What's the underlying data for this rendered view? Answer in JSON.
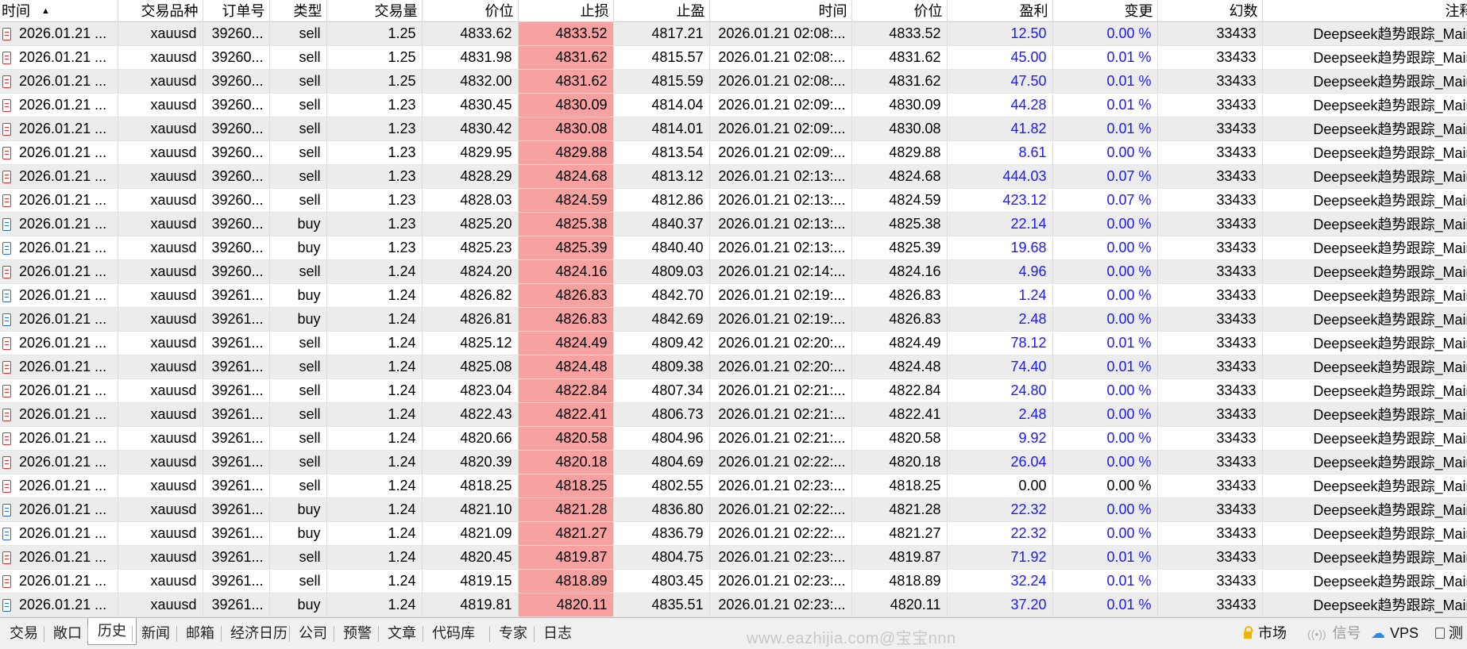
{
  "table": {
    "headers": [
      "时间",
      "交易品种",
      "订单号",
      "类型",
      "交易量",
      "价位",
      "止损",
      "止盈",
      "时间",
      "价位",
      "盈利",
      "变更",
      "幻数",
      "注释"
    ],
    "rows": [
      {
        "side": "sell",
        "time": "2026.01.21 ...",
        "symbol": "xauusd",
        "order": "39260...",
        "type": "sell",
        "volume": "1.25",
        "price": "4833.62",
        "sl": "4833.52",
        "tp": "4817.21",
        "close_time": "2026.01.21 02:08:...",
        "close_price": "4833.52",
        "profit": "12.50",
        "change": "0.00 %",
        "magic": "33433",
        "comment": "Deepseek趋势跟踪_Main",
        "profit_blue": true
      },
      {
        "side": "sell",
        "time": "2026.01.21 ...",
        "symbol": "xauusd",
        "order": "39260...",
        "type": "sell",
        "volume": "1.25",
        "price": "4831.98",
        "sl": "4831.62",
        "tp": "4815.57",
        "close_time": "2026.01.21 02:08:...",
        "close_price": "4831.62",
        "profit": "45.00",
        "change": "0.01 %",
        "magic": "33433",
        "comment": "Deepseek趋势跟踪_Main",
        "profit_blue": true
      },
      {
        "side": "sell",
        "time": "2026.01.21 ...",
        "symbol": "xauusd",
        "order": "39260...",
        "type": "sell",
        "volume": "1.25",
        "price": "4832.00",
        "sl": "4831.62",
        "tp": "4815.59",
        "close_time": "2026.01.21 02:08:...",
        "close_price": "4831.62",
        "profit": "47.50",
        "change": "0.01 %",
        "magic": "33433",
        "comment": "Deepseek趋势跟踪_Main",
        "profit_blue": true
      },
      {
        "side": "sell",
        "time": "2026.01.21 ...",
        "symbol": "xauusd",
        "order": "39260...",
        "type": "sell",
        "volume": "1.23",
        "price": "4830.45",
        "sl": "4830.09",
        "tp": "4814.04",
        "close_time": "2026.01.21 02:09:...",
        "close_price": "4830.09",
        "profit": "44.28",
        "change": "0.01 %",
        "magic": "33433",
        "comment": "Deepseek趋势跟踪_Main",
        "profit_blue": true
      },
      {
        "side": "sell",
        "time": "2026.01.21 ...",
        "symbol": "xauusd",
        "order": "39260...",
        "type": "sell",
        "volume": "1.23",
        "price": "4830.42",
        "sl": "4830.08",
        "tp": "4814.01",
        "close_time": "2026.01.21 02:09:...",
        "close_price": "4830.08",
        "profit": "41.82",
        "change": "0.01 %",
        "magic": "33433",
        "comment": "Deepseek趋势跟踪_Main",
        "profit_blue": true
      },
      {
        "side": "sell",
        "time": "2026.01.21 ...",
        "symbol": "xauusd",
        "order": "39260...",
        "type": "sell",
        "volume": "1.23",
        "price": "4829.95",
        "sl": "4829.88",
        "tp": "4813.54",
        "close_time": "2026.01.21 02:09:...",
        "close_price": "4829.88",
        "profit": "8.61",
        "change": "0.00 %",
        "magic": "33433",
        "comment": "Deepseek趋势跟踪_Main",
        "profit_blue": true
      },
      {
        "side": "sell",
        "time": "2026.01.21 ...",
        "symbol": "xauusd",
        "order": "39260...",
        "type": "sell",
        "volume": "1.23",
        "price": "4828.29",
        "sl": "4824.68",
        "tp": "4813.12",
        "close_time": "2026.01.21 02:13:...",
        "close_price": "4824.68",
        "profit": "444.03",
        "change": "0.07 %",
        "magic": "33433",
        "comment": "Deepseek趋势跟踪_Main",
        "profit_blue": true
      },
      {
        "side": "sell",
        "time": "2026.01.21 ...",
        "symbol": "xauusd",
        "order": "39260...",
        "type": "sell",
        "volume": "1.23",
        "price": "4828.03",
        "sl": "4824.59",
        "tp": "4812.86",
        "close_time": "2026.01.21 02:13:...",
        "close_price": "4824.59",
        "profit": "423.12",
        "change": "0.07 %",
        "magic": "33433",
        "comment": "Deepseek趋势跟踪_Main",
        "profit_blue": true
      },
      {
        "side": "buy",
        "time": "2026.01.21 ...",
        "symbol": "xauusd",
        "order": "39260...",
        "type": "buy",
        "volume": "1.23",
        "price": "4825.20",
        "sl": "4825.38",
        "tp": "4840.37",
        "close_time": "2026.01.21 02:13:...",
        "close_price": "4825.38",
        "profit": "22.14",
        "change": "0.00 %",
        "magic": "33433",
        "comment": "Deepseek趋势跟踪_Main",
        "profit_blue": true
      },
      {
        "side": "buy",
        "time": "2026.01.21 ...",
        "symbol": "xauusd",
        "order": "39260...",
        "type": "buy",
        "volume": "1.23",
        "price": "4825.23",
        "sl": "4825.39",
        "tp": "4840.40",
        "close_time": "2026.01.21 02:13:...",
        "close_price": "4825.39",
        "profit": "19.68",
        "change": "0.00 %",
        "magic": "33433",
        "comment": "Deepseek趋势跟踪_Main",
        "profit_blue": true
      },
      {
        "side": "sell",
        "time": "2026.01.21 ...",
        "symbol": "xauusd",
        "order": "39260...",
        "type": "sell",
        "volume": "1.24",
        "price": "4824.20",
        "sl": "4824.16",
        "tp": "4809.03",
        "close_time": "2026.01.21 02:14:...",
        "close_price": "4824.16",
        "profit": "4.96",
        "change": "0.00 %",
        "magic": "33433",
        "comment": "Deepseek趋势跟踪_Main",
        "profit_blue": true
      },
      {
        "side": "buy",
        "time": "2026.01.21 ...",
        "symbol": "xauusd",
        "order": "39261...",
        "type": "buy",
        "volume": "1.24",
        "price": "4826.82",
        "sl": "4826.83",
        "tp": "4842.70",
        "close_time": "2026.01.21 02:19:...",
        "close_price": "4826.83",
        "profit": "1.24",
        "change": "0.00 %",
        "magic": "33433",
        "comment": "Deepseek趋势跟踪_Main",
        "profit_blue": true
      },
      {
        "side": "buy",
        "time": "2026.01.21 ...",
        "symbol": "xauusd",
        "order": "39261...",
        "type": "buy",
        "volume": "1.24",
        "price": "4826.81",
        "sl": "4826.83",
        "tp": "4842.69",
        "close_time": "2026.01.21 02:19:...",
        "close_price": "4826.83",
        "profit": "2.48",
        "change": "0.00 %",
        "magic": "33433",
        "comment": "Deepseek趋势跟踪_Main",
        "profit_blue": true
      },
      {
        "side": "sell",
        "time": "2026.01.21 ...",
        "symbol": "xauusd",
        "order": "39261...",
        "type": "sell",
        "volume": "1.24",
        "price": "4825.12",
        "sl": "4824.49",
        "tp": "4809.42",
        "close_time": "2026.01.21 02:20:...",
        "close_price": "4824.49",
        "profit": "78.12",
        "change": "0.01 %",
        "magic": "33433",
        "comment": "Deepseek趋势跟踪_Main",
        "profit_blue": true
      },
      {
        "side": "sell",
        "time": "2026.01.21 ...",
        "symbol": "xauusd",
        "order": "39261...",
        "type": "sell",
        "volume": "1.24",
        "price": "4825.08",
        "sl": "4824.48",
        "tp": "4809.38",
        "close_time": "2026.01.21 02:20:...",
        "close_price": "4824.48",
        "profit": "74.40",
        "change": "0.01 %",
        "magic": "33433",
        "comment": "Deepseek趋势跟踪_Main",
        "profit_blue": true
      },
      {
        "side": "sell",
        "time": "2026.01.21 ...",
        "symbol": "xauusd",
        "order": "39261...",
        "type": "sell",
        "volume": "1.24",
        "price": "4823.04",
        "sl": "4822.84",
        "tp": "4807.34",
        "close_time": "2026.01.21 02:21:...",
        "close_price": "4822.84",
        "profit": "24.80",
        "change": "0.00 %",
        "magic": "33433",
        "comment": "Deepseek趋势跟踪_Main",
        "profit_blue": true
      },
      {
        "side": "sell",
        "time": "2026.01.21 ...",
        "symbol": "xauusd",
        "order": "39261...",
        "type": "sell",
        "volume": "1.24",
        "price": "4822.43",
        "sl": "4822.41",
        "tp": "4806.73",
        "close_time": "2026.01.21 02:21:...",
        "close_price": "4822.41",
        "profit": "2.48",
        "change": "0.00 %",
        "magic": "33433",
        "comment": "Deepseek趋势跟踪_Main",
        "profit_blue": true
      },
      {
        "side": "sell",
        "time": "2026.01.21 ...",
        "symbol": "xauusd",
        "order": "39261...",
        "type": "sell",
        "volume": "1.24",
        "price": "4820.66",
        "sl": "4820.58",
        "tp": "4804.96",
        "close_time": "2026.01.21 02:21:...",
        "close_price": "4820.58",
        "profit": "9.92",
        "change": "0.00 %",
        "magic": "33433",
        "comment": "Deepseek趋势跟踪_Main",
        "profit_blue": true
      },
      {
        "side": "sell",
        "time": "2026.01.21 ...",
        "symbol": "xauusd",
        "order": "39261...",
        "type": "sell",
        "volume": "1.24",
        "price": "4820.39",
        "sl": "4820.18",
        "tp": "4804.69",
        "close_time": "2026.01.21 02:22:...",
        "close_price": "4820.18",
        "profit": "26.04",
        "change": "0.00 %",
        "magic": "33433",
        "comment": "Deepseek趋势跟踪_Main",
        "profit_blue": true
      },
      {
        "side": "sell",
        "time": "2026.01.21 ...",
        "symbol": "xauusd",
        "order": "39261...",
        "type": "sell",
        "volume": "1.24",
        "price": "4818.25",
        "sl": "4818.25",
        "tp": "4802.55",
        "close_time": "2026.01.21 02:23:...",
        "close_price": "4818.25",
        "profit": "0.00",
        "change": "0.00 %",
        "magic": "33433",
        "comment": "Deepseek趋势跟踪_Main",
        "profit_blue": false
      },
      {
        "side": "buy",
        "time": "2026.01.21 ...",
        "symbol": "xauusd",
        "order": "39261...",
        "type": "buy",
        "volume": "1.24",
        "price": "4821.10",
        "sl": "4821.28",
        "tp": "4836.80",
        "close_time": "2026.01.21 02:22:...",
        "close_price": "4821.28",
        "profit": "22.32",
        "change": "0.00 %",
        "magic": "33433",
        "comment": "Deepseek趋势跟踪_Main",
        "profit_blue": true
      },
      {
        "side": "buy",
        "time": "2026.01.21 ...",
        "symbol": "xauusd",
        "order": "39261...",
        "type": "buy",
        "volume": "1.24",
        "price": "4821.09",
        "sl": "4821.27",
        "tp": "4836.79",
        "close_time": "2026.01.21 02:22:...",
        "close_price": "4821.27",
        "profit": "22.32",
        "change": "0.00 %",
        "magic": "33433",
        "comment": "Deepseek趋势跟踪_Main",
        "profit_blue": true
      },
      {
        "side": "sell",
        "time": "2026.01.21 ...",
        "symbol": "xauusd",
        "order": "39261...",
        "type": "sell",
        "volume": "1.24",
        "price": "4820.45",
        "sl": "4819.87",
        "tp": "4804.75",
        "close_time": "2026.01.21 02:23:...",
        "close_price": "4819.87",
        "profit": "71.92",
        "change": "0.01 %",
        "magic": "33433",
        "comment": "Deepseek趋势跟踪_Main",
        "profit_blue": true
      },
      {
        "side": "sell",
        "time": "2026.01.21 ...",
        "symbol": "xauusd",
        "order": "39261...",
        "type": "sell",
        "volume": "1.24",
        "price": "4819.15",
        "sl": "4818.89",
        "tp": "4803.45",
        "close_time": "2026.01.21 02:23:...",
        "close_price": "4818.89",
        "profit": "32.24",
        "change": "0.01 %",
        "magic": "33433",
        "comment": "Deepseek趋势跟踪_Main",
        "profit_blue": true
      },
      {
        "side": "buy",
        "time": "2026.01.21 ...",
        "symbol": "xauusd",
        "order": "39261...",
        "type": "buy",
        "volume": "1.24",
        "price": "4819.81",
        "sl": "4820.11",
        "tp": "4835.51",
        "close_time": "2026.01.21 02:23:...",
        "close_price": "4820.11",
        "profit": "37.20",
        "change": "0.01 %",
        "magic": "33433",
        "comment": "Deepseek趋势跟踪_Main",
        "profit_blue": true
      }
    ]
  },
  "tabs": [
    "交易",
    "敞口",
    "历史",
    "新闻",
    "邮箱",
    "经济日历",
    "公司",
    "预警",
    "文章",
    "代码库",
    "专家",
    "日志"
  ],
  "active_tab": "历史",
  "watermark": "www.eazhijia.com@宝宝nnn",
  "status": {
    "market": "市场",
    "signal": "信号",
    "vps": "VPS",
    "test": "测"
  },
  "colors": {
    "stop_loss_bg": "#f7a1a1",
    "profit_blue": "#1a1aff",
    "sell_icon": "#e03030",
    "buy_icon": "#2a6fd6"
  },
  "icons": {
    "sell_row": "document-red-icon",
    "buy_row": "document-blue-icon",
    "sort": "sort-ascending-icon"
  }
}
